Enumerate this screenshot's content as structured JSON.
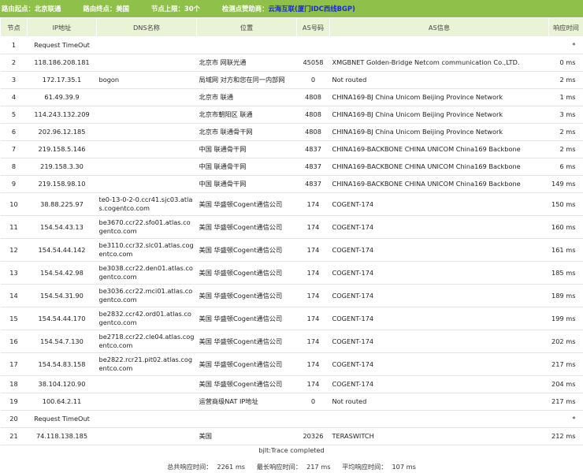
{
  "header": {
    "origin_label": "路由起点：北京联通",
    "dest_label": "路由终点：美国",
    "hops_label": "节点上限：30个",
    "sponsor_label": "检测点赞助商：",
    "sponsor_name": "云海互联",
    "sponsor_detail": "(厦门IDC西线BGP)"
  },
  "columns": [
    "节点",
    "IP地址",
    "DNS名称",
    "位置",
    "AS号码",
    "AS信息",
    "响应时间"
  ],
  "rows": [
    {
      "hop": "1",
      "ip": "Request TimeOut",
      "dns": "",
      "loc": "",
      "asn": "",
      "asinfo": "",
      "time": "*"
    },
    {
      "hop": "2",
      "ip": "118.186.208.181",
      "dns": "",
      "loc": "北京市 网联光通",
      "asn": "45058",
      "asinfo": "XMGBNET Golden-Bridge Netcom communication Co.,LTD.",
      "time": "0 ms"
    },
    {
      "hop": "3",
      "ip": "172.17.35.1",
      "dns": "bogon",
      "loc": "局域网 对方和您在同一内部网",
      "asn": "0",
      "asinfo": "Not routed",
      "time": "2 ms"
    },
    {
      "hop": "4",
      "ip": "61.49.39.9",
      "dns": "",
      "loc": "北京市 联通",
      "asn": "4808",
      "asinfo": "CHINA169-BJ China Unicom Beijing Province Network",
      "time": "1 ms"
    },
    {
      "hop": "5",
      "ip": "114.243.132.209",
      "dns": "",
      "loc": "北京市朝阳区 联通",
      "asn": "4808",
      "asinfo": "CHINA169-BJ China Unicom Beijing Province Network",
      "time": "3 ms"
    },
    {
      "hop": "6",
      "ip": "202.96.12.185",
      "dns": "",
      "loc": "北京市 联通骨干网",
      "asn": "4808",
      "asinfo": "CHINA169-BJ China Unicom Beijing Province Network",
      "time": "2 ms"
    },
    {
      "hop": "7",
      "ip": "219.158.5.146",
      "dns": "",
      "loc": "中国 联通骨干网",
      "asn": "4837",
      "asinfo": "CHINA169-BACKBONE CHINA UNICOM China169 Backbone",
      "time": "2 ms"
    },
    {
      "hop": "8",
      "ip": "219.158.3.30",
      "dns": "",
      "loc": "中国 联通骨干网",
      "asn": "4837",
      "asinfo": "CHINA169-BACKBONE CHINA UNICOM China169 Backbone",
      "time": "6 ms"
    },
    {
      "hop": "9",
      "ip": "219.158.98.10",
      "dns": "",
      "loc": "中国 联通骨干网",
      "asn": "4837",
      "asinfo": "CHINA169-BACKBONE CHINA UNICOM China169 Backbone",
      "time": "149 ms"
    },
    {
      "hop": "10",
      "ip": "38.88.225.97",
      "dns": "te0-13-0-2-0.ccr41.sjc03.atlas.cogentco.com",
      "loc": "美国 华盛顿Cogent通信公司",
      "asn": "174",
      "asinfo": "COGENT-174",
      "time": "150 ms"
    },
    {
      "hop": "11",
      "ip": "154.54.43.13",
      "dns": "be3670.ccr22.sfo01.atlas.cogentco.com",
      "loc": "美国 华盛顿Cogent通信公司",
      "asn": "174",
      "asinfo": "COGENT-174",
      "time": "160 ms"
    },
    {
      "hop": "12",
      "ip": "154.54.44.142",
      "dns": "be3110.ccr32.slc01.atlas.cogentco.com",
      "loc": "美国 华盛顿Cogent通信公司",
      "asn": "174",
      "asinfo": "COGENT-174",
      "time": "161 ms"
    },
    {
      "hop": "13",
      "ip": "154.54.42.98",
      "dns": "be3038.ccr22.den01.atlas.cogentco.com",
      "loc": "美国 华盛顿Cogent通信公司",
      "asn": "174",
      "asinfo": "COGENT-174",
      "time": "185 ms"
    },
    {
      "hop": "14",
      "ip": "154.54.31.90",
      "dns": "be3036.ccr22.mci01.atlas.cogentco.com",
      "loc": "美国 华盛顿Cogent通信公司",
      "asn": "174",
      "asinfo": "COGENT-174",
      "time": "189 ms"
    },
    {
      "hop": "15",
      "ip": "154.54.44.170",
      "dns": "be2832.ccr42.ord01.atlas.cogentco.com",
      "loc": "美国 华盛顿Cogent通信公司",
      "asn": "174",
      "asinfo": "COGENT-174",
      "time": "199 ms"
    },
    {
      "hop": "16",
      "ip": "154.54.7.130",
      "dns": "be2718.ccr22.cle04.atlas.cogentco.com",
      "loc": "美国 华盛顿Cogent通信公司",
      "asn": "174",
      "asinfo": "COGENT-174",
      "time": "202 ms"
    },
    {
      "hop": "17",
      "ip": "154.54.83.158",
      "dns": "be2822.rcr21.pit02.atlas.cogentco.com",
      "loc": "美国 华盛顿Cogent通信公司",
      "asn": "174",
      "asinfo": "COGENT-174",
      "time": "217 ms"
    },
    {
      "hop": "18",
      "ip": "38.104.120.90",
      "dns": "",
      "loc": "美国 华盛顿Cogent通信公司",
      "asn": "174",
      "asinfo": "COGENT-174",
      "time": "204 ms"
    },
    {
      "hop": "19",
      "ip": "100.64.2.11",
      "dns": "",
      "loc": "运营商级NAT IP地址",
      "asn": "0",
      "asinfo": "Not routed",
      "time": "217 ms"
    },
    {
      "hop": "20",
      "ip": "Request TimeOut",
      "dns": "",
      "loc": "",
      "asn": "",
      "asinfo": "",
      "time": "*"
    },
    {
      "hop": "21",
      "ip": "74.118.138.185",
      "dns": "",
      "loc": "美国",
      "asn": "20326",
      "asinfo": "TERASWITCH",
      "time": "212 ms"
    }
  ],
  "footer": {
    "status": "bjlt:Trace completed",
    "total_label": "总共响应时间：",
    "total_value": "2261 ms",
    "max_label": "最长响应时间：",
    "max_value": "217 ms",
    "avg_label": "平均响应时间：",
    "avg_value": "107 ms"
  },
  "colors": {
    "header_bar": "#8fc04a",
    "column_header": "#eaf3d6",
    "sponsor_link": "#1a2bd8"
  }
}
